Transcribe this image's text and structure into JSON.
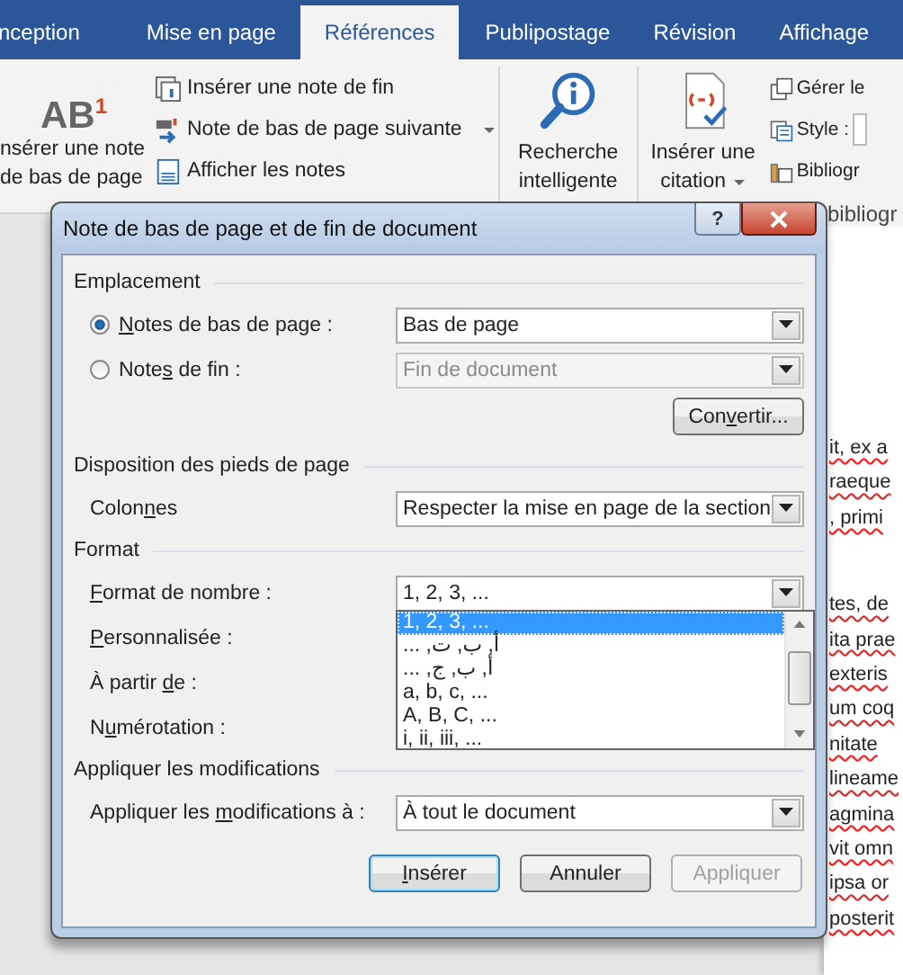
{
  "tabs": [
    {
      "label": "nception",
      "selected": false
    },
    {
      "label": "Mise en page",
      "selected": false
    },
    {
      "label": "Références",
      "selected": true
    },
    {
      "label": "Publipostage",
      "selected": false
    },
    {
      "label": "Révision",
      "selected": false
    },
    {
      "label": "Affichage",
      "selected": false
    }
  ],
  "ribbon": {
    "footnote_button": {
      "icon_text": "AB",
      "icon_sup": "1",
      "lines": [
        "nsérer une note",
        "de bas de page"
      ]
    },
    "note_commands": [
      {
        "label": "Insérer une note de fin",
        "kind": "endnote"
      },
      {
        "label": "Note de bas de page suivante",
        "kind": "next"
      },
      {
        "label": "Afficher les notes",
        "kind": "show"
      }
    ],
    "smart_lookup": {
      "lines": [
        "Recherche",
        "intelligente"
      ]
    },
    "citation": {
      "lines": [
        "Insérer une",
        "citation"
      ]
    },
    "citation_commands": [
      {
        "label": "Gérer le",
        "kind": "manage"
      },
      {
        "label": "Style :",
        "kind": "style"
      },
      {
        "label": "Bibliogr",
        "kind": "biblio"
      }
    ],
    "group_label": "bibliogr"
  },
  "document_paragraphs": [
    [
      "it, ex a",
      "raeque",
      ", primi"
    ],
    [
      "tes, de",
      "ita prae",
      "exteris",
      "um coq",
      "nitate",
      "lineame",
      "agmina",
      "vit omn",
      "ipsa or",
      "posterit"
    ]
  ],
  "dialog": {
    "title": "Note de bas de page et de fin de document",
    "help": "?",
    "sections": [
      {
        "title": "Emplacement",
        "rows": [
          {
            "kind": "radio",
            "label": {
              "key": "N",
              "post": "otes de bas de page :"
            },
            "selected": true,
            "value": "Bas de page",
            "disabled": false
          },
          {
            "kind": "radio",
            "label": {
              "pre": "Note",
              "key": "s",
              "post": " de fin :"
            },
            "selected": false,
            "value": "Fin de document",
            "disabled": true
          },
          {
            "kind": "button",
            "label": {
              "pre": "Con",
              "key": "v",
              "post": "ertir..."
            }
          }
        ]
      },
      {
        "title": "Disposition des pieds de page",
        "rows": [
          {
            "kind": "dropdown",
            "label": {
              "pre": "Colon",
              "key": "n",
              "post": "es"
            },
            "value": "Respecter la mise en page de la section"
          }
        ]
      },
      {
        "title": "Format",
        "rows": [
          {
            "kind": "open",
            "label": {
              "key": "F",
              "post": "ormat de nombre :"
            },
            "value": "1, 2, 3, ...",
            "options": [
              {
                "label": "1, 2, 3, ...",
                "selected": true
              },
              {
                "label": "أ, ب, ت, ...",
                "selected": false
              },
              {
                "label": "أ, ب, ج, ...",
                "selected": false
              },
              {
                "label": "a, b, c, ...",
                "selected": false
              },
              {
                "label": "A, B, C, ...",
                "selected": false
              },
              {
                "label": "i, ii, iii, ...",
                "selected": false
              }
            ]
          },
          {
            "kind": "label",
            "label": {
              "key": "P",
              "post": "ersonnalisée :"
            }
          },
          {
            "kind": "label",
            "label": {
              "pre": "À partir ",
              "key": "d",
              "post": "e :"
            }
          },
          {
            "kind": "label",
            "label": {
              "pre": "N",
              "key": "u",
              "post": "mérotation :"
            }
          }
        ]
      },
      {
        "title": "Appliquer les modifications",
        "rows": [
          {
            "kind": "dropdown",
            "label": {
              "pre": "Appliquer les ",
              "key": "m",
              "post": "odifications à :"
            },
            "value": "À tout le document"
          }
        ]
      }
    ],
    "buttons": [
      {
        "label": {
          "key": "I",
          "post": "nsérer"
        },
        "kind": "default",
        "disabled": false
      },
      {
        "label": {
          "pre": "Annuler"
        },
        "kind": "normal",
        "disabled": false
      },
      {
        "label": {
          "pre": "Appliquer"
        },
        "kind": "normal",
        "disabled": true
      }
    ]
  }
}
